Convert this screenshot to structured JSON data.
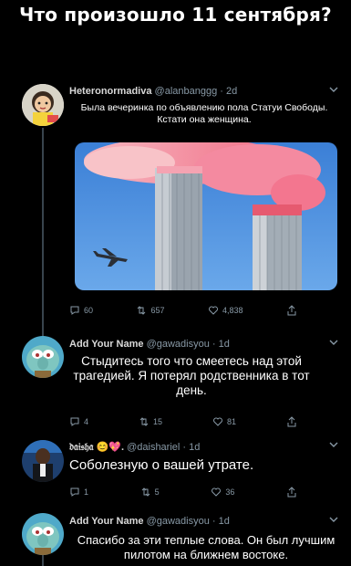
{
  "meme": {
    "title": "Что произошло 11 сентября?"
  },
  "tweets": [
    {
      "name": "Heteronormadiva",
      "handle": "@alanbanggg",
      "time": "· 2d",
      "text": "Была вечеринка по объявлению пола Статуи Свободы. Кстати она женщина.",
      "replies": "60",
      "retweets": "657",
      "likes": "4,838"
    },
    {
      "name": "Add Your Name",
      "handle": "@gawadisyou",
      "time": "· 1d",
      "text": "Стыдитесь того что смеетесь над этой трагедией. Я потерял родственника в тот день.",
      "replies": "4",
      "retweets": "15",
      "likes": "81"
    },
    {
      "name": "𝔡𝔞𝔦𝔰𝔥𝔞 😊💖.",
      "handle": "@daishariel",
      "time": "· 1d",
      "text": "Соболезную о вашей утрате.",
      "replies": "1",
      "retweets": "5",
      "likes": "36"
    },
    {
      "name": "Add Your Name",
      "handle": "@gawadisyou",
      "time": "· 1d",
      "text": "Спасибо за эти теплые слова. Он был лучшим пилотом на ближнем востоке."
    }
  ],
  "icons": {
    "reply": "reply-icon",
    "retweet": "retweet-icon",
    "like": "heart-icon",
    "share": "share-icon",
    "more": "chevron-down-icon"
  },
  "colors": {
    "background": "#000000",
    "secondary_text": "#8899a6",
    "thread_line": "#38444d"
  }
}
